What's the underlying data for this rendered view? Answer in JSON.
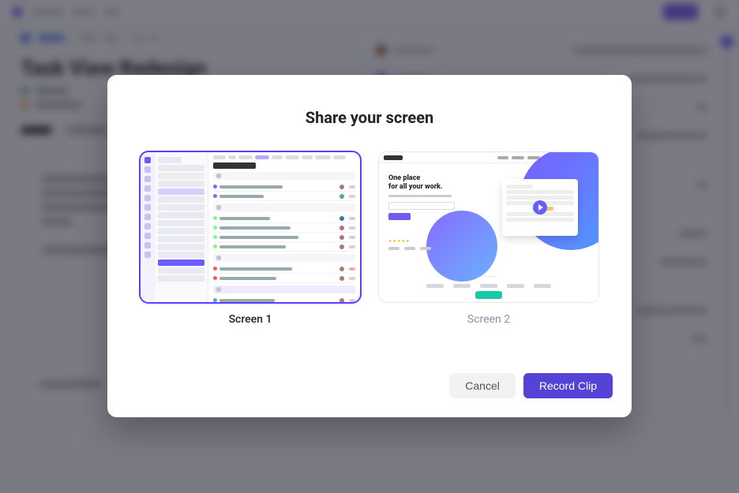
{
  "background": {
    "title": "Task View Redesign"
  },
  "modal": {
    "title": "Share your screen",
    "options": [
      {
        "label": "Screen 1",
        "selected": true
      },
      {
        "label": "Screen 2",
        "selected": false
      }
    ],
    "cancel_label": "Cancel",
    "record_label": "Record Clip",
    "preview2": {
      "headline_1": "One place",
      "headline_2": "for all your work."
    }
  }
}
